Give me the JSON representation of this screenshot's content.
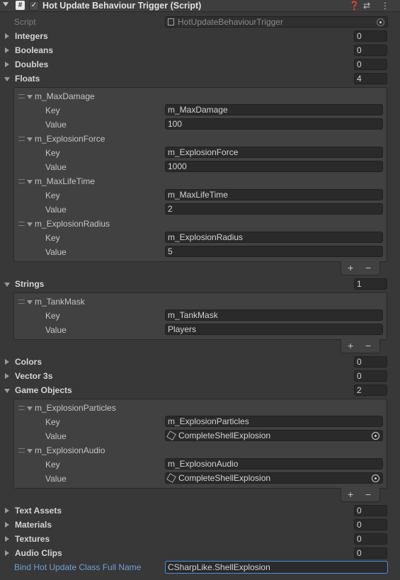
{
  "header": {
    "title": "Hot Update Behaviour Trigger (Script)",
    "enabled": true,
    "icons": [
      "help-icon",
      "presets-icon",
      "context-menu-icon"
    ]
  },
  "script": {
    "label": "Script",
    "value": "HotUpdateBehaviourTrigger"
  },
  "sections": {
    "integers": {
      "label": "Integers",
      "count": "0"
    },
    "booleans": {
      "label": "Booleans",
      "count": "0"
    },
    "doubles": {
      "label": "Doubles",
      "count": "0"
    },
    "floats": {
      "label": "Floats",
      "count": "4",
      "items": [
        {
          "name": "m_MaxDamage",
          "key_label": "Key",
          "value_label": "Value",
          "key": "m_MaxDamage",
          "value": "100"
        },
        {
          "name": "m_ExplosionForce",
          "key_label": "Key",
          "value_label": "Value",
          "key": "m_ExplosionForce",
          "value": "1000"
        },
        {
          "name": "m_MaxLifeTime",
          "key_label": "Key",
          "value_label": "Value",
          "key": "m_MaxLifeTime",
          "value": "2"
        },
        {
          "name": "m_ExplosionRadius",
          "key_label": "Key",
          "value_label": "Value",
          "key": "m_ExplosionRadius",
          "value": "5"
        }
      ]
    },
    "strings": {
      "label": "Strings",
      "count": "1",
      "items": [
        {
          "name": "m_TankMask",
          "key_label": "Key",
          "value_label": "Value",
          "key": "m_TankMask",
          "value": "Players"
        }
      ]
    },
    "colors": {
      "label": "Colors",
      "count": "0"
    },
    "vector3s": {
      "label": "Vector 3s",
      "count": "0"
    },
    "game_objects": {
      "label": "Game Objects",
      "count": "2",
      "items": [
        {
          "name": "m_ExplosionParticles",
          "key_label": "Key",
          "value_label": "Value",
          "key": "m_ExplosionParticles",
          "value": "CompleteShellExplosion"
        },
        {
          "name": "m_ExplosionAudio",
          "key_label": "Key",
          "value_label": "Value",
          "key": "m_ExplosionAudio",
          "value": "CompleteShellExplosion"
        }
      ]
    },
    "text_assets": {
      "label": "Text Assets",
      "count": "0"
    },
    "materials": {
      "label": "Materials",
      "count": "0"
    },
    "textures": {
      "label": "Textures",
      "count": "0"
    },
    "audio_clips": {
      "label": "Audio Clips",
      "count": "0"
    }
  },
  "list_controls": {
    "add": "+",
    "remove": "−"
  },
  "bind_class": {
    "label": "Bind Hot Update Class Full Name",
    "value": "CSharpLike.ShellExplosion"
  },
  "colors": {
    "background": "#383838",
    "field": "#2a2a2a",
    "panel": "#414141",
    "accent_blue": "#6f9fd8"
  }
}
